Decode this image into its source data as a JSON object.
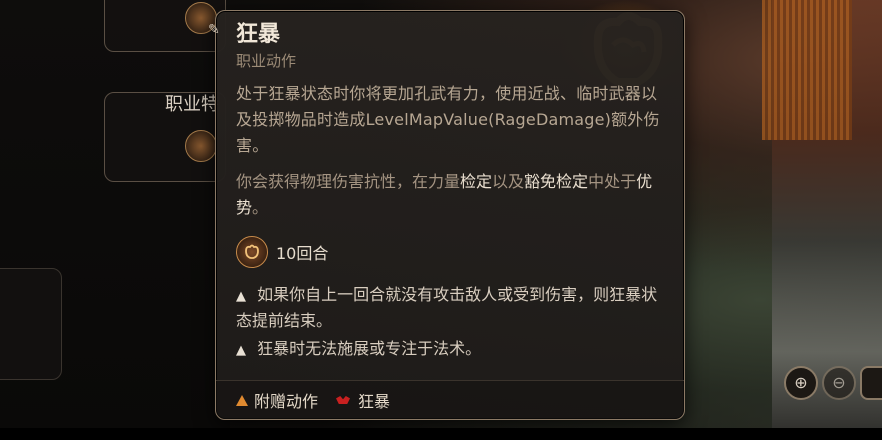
{
  "background": {
    "slot_label": "职业特"
  },
  "tooltip": {
    "title": "狂暴",
    "subtitle": "职业动作",
    "description": "处于狂暴状态时你将更加孔武有力，使用近战、临时武器以及投掷物品时造成LevelMapValue(RageDamage)额外伤害。",
    "desc2": {
      "part1": "你会获得物理伤害抗性，在力量",
      "hl1": "检定",
      "part2": "以及",
      "hl2": "豁免检定",
      "part3": "中处于",
      "hl3": "优势",
      "part4": "。"
    },
    "duration": "10回合",
    "warnings": [
      "如果你自上一回合就没有攻击敌人或受到伤害，则狂暴状态提前结束。",
      "狂暴时无法施展或专注于法术。"
    ],
    "footer": {
      "action_type": "附赠动作",
      "resource": "狂暴"
    }
  },
  "colors": {
    "title": "#f1e7d8",
    "subtitle": "#9c8b77",
    "border": "#8c7a66",
    "accent_orange": "#e08a30",
    "rage_red": "#c82020"
  },
  "icons": [
    "pin-icon",
    "rage-fist-icon",
    "warning-icon",
    "triangle-icon",
    "rage-resource-icon",
    "zoom-in-icon",
    "zoom-out-icon"
  ]
}
